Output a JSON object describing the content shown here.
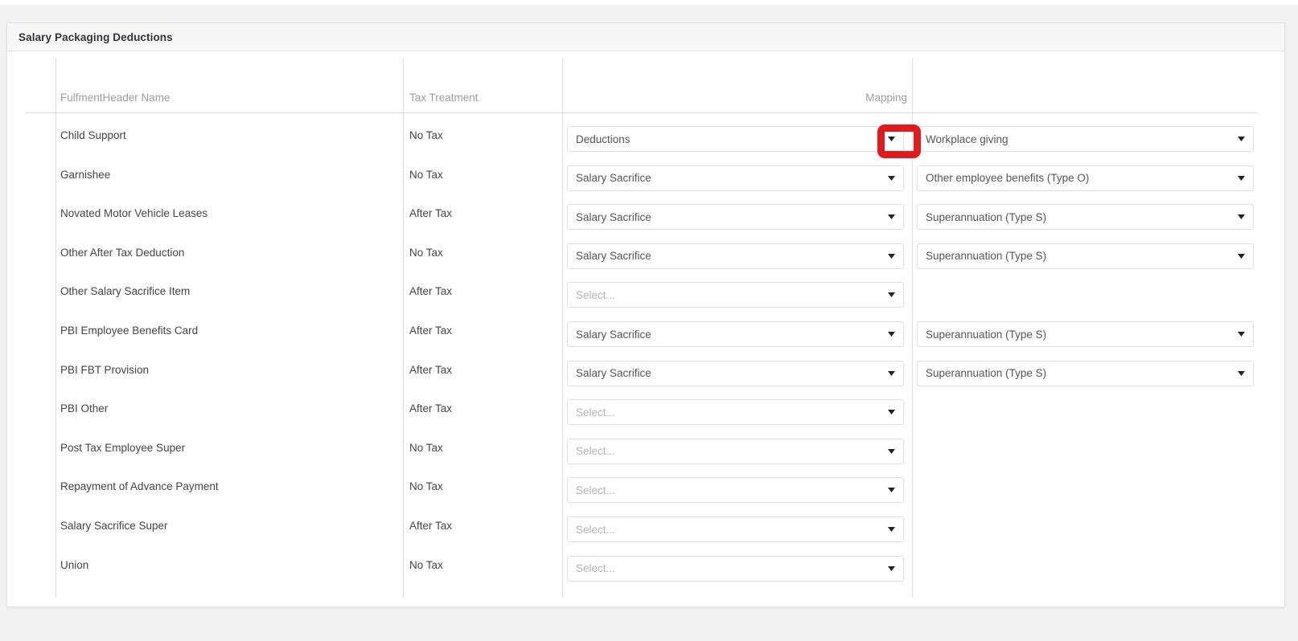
{
  "card": {
    "title": "Salary Packaging Deductions"
  },
  "table": {
    "columns": [
      {
        "key": "name",
        "label": "FulfmentHeader Name"
      },
      {
        "key": "tax",
        "label": "Tax Treatment"
      },
      {
        "key": "mapping",
        "label": "Mapping"
      }
    ],
    "select_placeholder": "Select...",
    "rows": [
      {
        "name": "Child Support",
        "tax": "No Tax",
        "mapping_primary": "Deductions",
        "mapping_secondary": "Workplace giving",
        "highlighted": true
      },
      {
        "name": "Garnishee",
        "tax": "No Tax",
        "mapping_primary": "Salary Sacrifice",
        "mapping_secondary": "Other employee benefits (Type O)",
        "highlighted": false
      },
      {
        "name": "Novated Motor Vehicle Leases",
        "tax": "After Tax",
        "mapping_primary": "Salary Sacrifice",
        "mapping_secondary": "Superannuation (Type S)",
        "highlighted": false
      },
      {
        "name": "Other After Tax Deduction",
        "tax": "No Tax",
        "mapping_primary": "Salary Sacrifice",
        "mapping_secondary": "Superannuation (Type S)",
        "highlighted": false
      },
      {
        "name": "Other Salary Sacrifice Item",
        "tax": "After Tax",
        "mapping_primary": "",
        "mapping_secondary": null,
        "highlighted": false
      },
      {
        "name": "PBI Employee Benefits Card",
        "tax": "After Tax",
        "mapping_primary": "Salary Sacrifice",
        "mapping_secondary": "Superannuation (Type S)",
        "highlighted": false
      },
      {
        "name": "PBI FBT Provision",
        "tax": "After Tax",
        "mapping_primary": "Salary Sacrifice",
        "mapping_secondary": "Superannuation (Type S)",
        "highlighted": false
      },
      {
        "name": "PBI Other",
        "tax": "After Tax",
        "mapping_primary": "",
        "mapping_secondary": null,
        "highlighted": false
      },
      {
        "name": "Post Tax Employee Super",
        "tax": "No Tax",
        "mapping_primary": "",
        "mapping_secondary": null,
        "highlighted": false
      },
      {
        "name": "Repayment of Advance Payment",
        "tax": "No Tax",
        "mapping_primary": "",
        "mapping_secondary": null,
        "highlighted": false
      },
      {
        "name": "Salary Sacrifice Super",
        "tax": "After Tax",
        "mapping_primary": "",
        "mapping_secondary": null,
        "highlighted": false
      },
      {
        "name": "Union",
        "tax": "No Tax",
        "mapping_primary": "",
        "mapping_secondary": null,
        "highlighted": false
      }
    ]
  },
  "annotation": {
    "color": "#e01b1b",
    "target": "row-1-mapping-primary-caret"
  },
  "colors": {
    "page_background": "#f2f2f2",
    "card_background": "#ffffff",
    "header_background": "#f7f7f7",
    "border": "#e0e0e0",
    "text": "#444449",
    "muted_text": "#9d9d9d",
    "placeholder_text": "#b4b4b4",
    "highlight": "#e01b1b"
  }
}
